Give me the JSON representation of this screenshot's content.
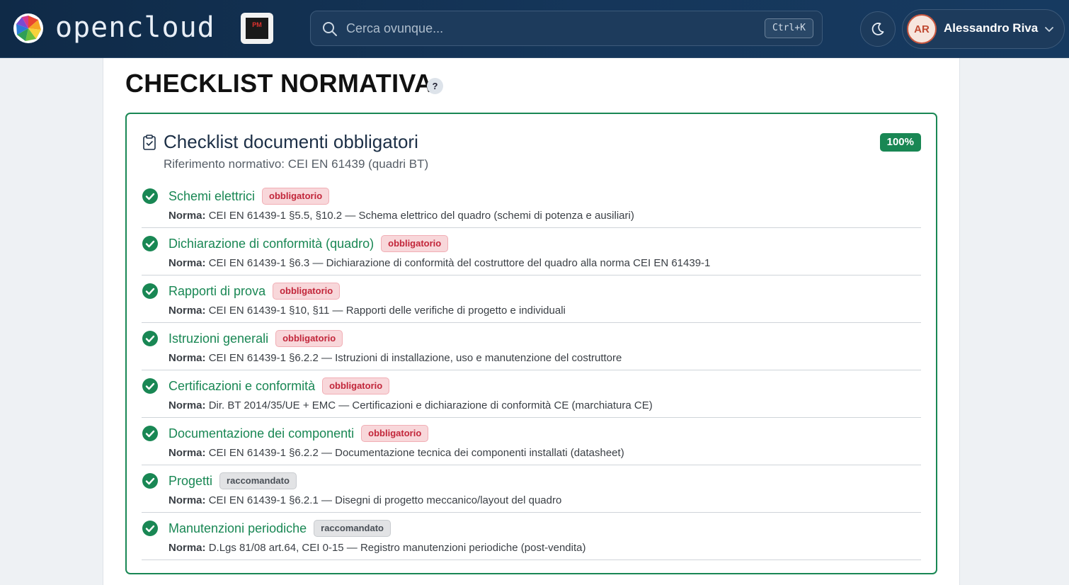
{
  "header": {
    "brand": "opencloud",
    "badge_text": "PM",
    "search_placeholder": "Cerca ovunque...",
    "search_shortcut": "Ctrl+K",
    "user_initials": "AR",
    "user_name": "Alessandro Riva"
  },
  "page": {
    "title": "CHECKLIST NORMATIVA",
    "help": "?"
  },
  "card": {
    "title": "Checklist documenti obbligatori",
    "subtitle": "Riferimento normativo: CEI EN 61439 (quadri BT)",
    "percent": "100%",
    "norm_label": "Norma:",
    "items": [
      {
        "name": "Schemi elettrici",
        "tag": "obbligatorio",
        "norm": "CEI EN 61439-1 §5.5, §10.2 — Schema elettrico del quadro (schemi di potenza e ausiliari)"
      },
      {
        "name": "Dichiarazione di conformità (quadro)",
        "tag": "obbligatorio",
        "norm": "CEI EN 61439-1 §6.3 — Dichiarazione di conformità del costruttore del quadro alla norma CEI EN 61439-1"
      },
      {
        "name": "Rapporti di prova",
        "tag": "obbligatorio",
        "norm": "CEI EN 61439-1 §10, §11 — Rapporti delle verifiche di progetto e individuali"
      },
      {
        "name": "Istruzioni generali",
        "tag": "obbligatorio",
        "norm": "CEI EN 61439-1 §6.2.2 — Istruzioni di installazione, uso e manutenzione del costruttore"
      },
      {
        "name": "Certificazioni e conformità",
        "tag": "obbligatorio",
        "norm": "Dir. BT 2014/35/UE + EMC — Certificazioni e dichiarazione di conformità CE (marchiatura CE)"
      },
      {
        "name": "Documentazione dei componenti",
        "tag": "obbligatorio",
        "norm": "CEI EN 61439-1 §6.2.2 — Documentazione tecnica dei componenti installati (datasheet)"
      },
      {
        "name": "Progetti",
        "tag": "raccomandato",
        "norm": "CEI EN 61439-1 §6.2.1 — Disegni di progetto meccanico/layout del quadro"
      },
      {
        "name": "Manutenzioni periodiche",
        "tag": "raccomandato",
        "norm": "D.Lgs 81/08 art.64, CEI 0-15 — Registro manutenzioni periodiche (post-vendita)"
      }
    ]
  },
  "colors": {
    "success": "#198754",
    "required_text": "#c2263a",
    "recommended_text": "#4a5057",
    "topbar": "#15365a"
  }
}
